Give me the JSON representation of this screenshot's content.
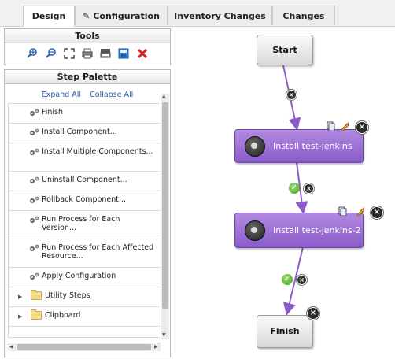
{
  "tabs": [
    {
      "label": "Design",
      "active": true
    },
    {
      "label": "Configuration",
      "icon": "pencil-icon"
    },
    {
      "label": "Inventory Changes"
    },
    {
      "label": "Changes"
    }
  ],
  "tools": {
    "title": "Tools",
    "icons": [
      "zoom-in-icon",
      "zoom-out-icon",
      "fit-screen-icon",
      "print-icon",
      "print-preview-icon",
      "save-icon",
      "delete-icon"
    ]
  },
  "palette": {
    "title": "Step Palette",
    "expand_all": "Expand All",
    "collapse_all": "Collapse All",
    "items": [
      "Finish",
      "Install Component...",
      "Install Multiple Components...",
      "Uninstall Component...",
      "Rollback Component...",
      "Run Process for Each Version...",
      "Run Process for Each Affected Resource...",
      "Apply Configuration"
    ],
    "folders": [
      "Utility Steps",
      "Clipboard"
    ]
  },
  "canvas": {
    "start_label": "Start",
    "steps": [
      "Install test-jenkins",
      "Install test-jenkins-2"
    ],
    "finish_label": "Finish",
    "colors": {
      "step": "#8a5ccb",
      "connector": "#8a5ccb",
      "success": "#3f9b1f"
    }
  }
}
